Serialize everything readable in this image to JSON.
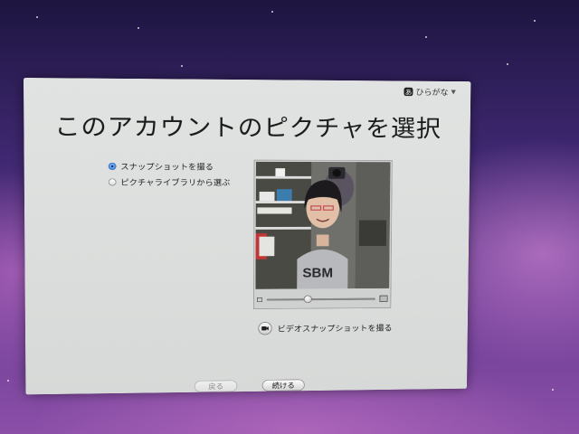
{
  "ime": {
    "label": "ひらがな",
    "badge": "あ",
    "arrow": "▼"
  },
  "title": "このアカウントのピクチャを選択",
  "options": [
    {
      "label": "スナップショットを撮る",
      "selected": true
    },
    {
      "label": "ピクチャライブラリから選ぶ",
      "selected": false
    }
  ],
  "photo": {
    "zoom_level": 0.38
  },
  "video_snapshot_label": "ビデオスナップショットを撮る",
  "buttons": {
    "back": "戻る",
    "continue": "続ける"
  },
  "colors": {
    "accent": "#2f78d8",
    "window": "#dcdedd"
  }
}
